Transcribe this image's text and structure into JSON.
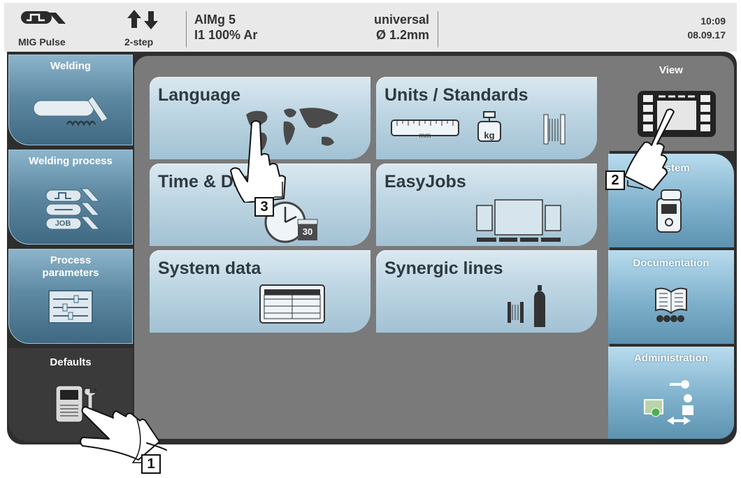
{
  "status_bar": {
    "process_label": "MIG Pulse",
    "mode_label": "2-step",
    "material_line1": "AlMg 5",
    "material_line2": "I1 100% Ar",
    "wire_line1": "universal",
    "wire_line2": "Ø  1.2mm",
    "time": "10:09",
    "date": "08.09.17"
  },
  "left_tabs": [
    {
      "label": "Welding",
      "icon": "welding-torch-icon"
    },
    {
      "label": "Welding process",
      "icon": "welding-process-icon",
      "badge": "JOB"
    },
    {
      "label": "Process parameters",
      "icon": "parameter-sliders-icon"
    },
    {
      "label": "Defaults",
      "icon": "device-wrench-icon",
      "active": true
    }
  ],
  "tiles": [
    {
      "label": "Language",
      "icon": "world-map-icon"
    },
    {
      "label": "Units / Standards",
      "icon": "units-icon",
      "ruler_unit": "mm",
      "weight_unit": "kg"
    },
    {
      "label": "Time & Date",
      "icon": "clock-calendar-icon",
      "calendar_day": "30"
    },
    {
      "label": "EasyJobs",
      "icon": "easyjobs-icon"
    },
    {
      "label": "System data",
      "icon": "table-icon"
    },
    {
      "label": "Synergic lines",
      "icon": "wire-gas-icon"
    }
  ],
  "right_tabs": [
    {
      "label": "View",
      "icon": "control-panel-icon",
      "active": true
    },
    {
      "label": "System",
      "icon": "welding-device-icon"
    },
    {
      "label": "Documentation",
      "icon": "book-icon"
    },
    {
      "label": "Administration",
      "icon": "user-key-icon"
    }
  ],
  "callouts": [
    "1",
    "2",
    "3"
  ],
  "colors": {
    "tab_blue": "#5f8aa3",
    "tile_light": "#c0d7e4",
    "center_gray": "#7a7a7a",
    "frame_dark": "#2e2e2e"
  }
}
